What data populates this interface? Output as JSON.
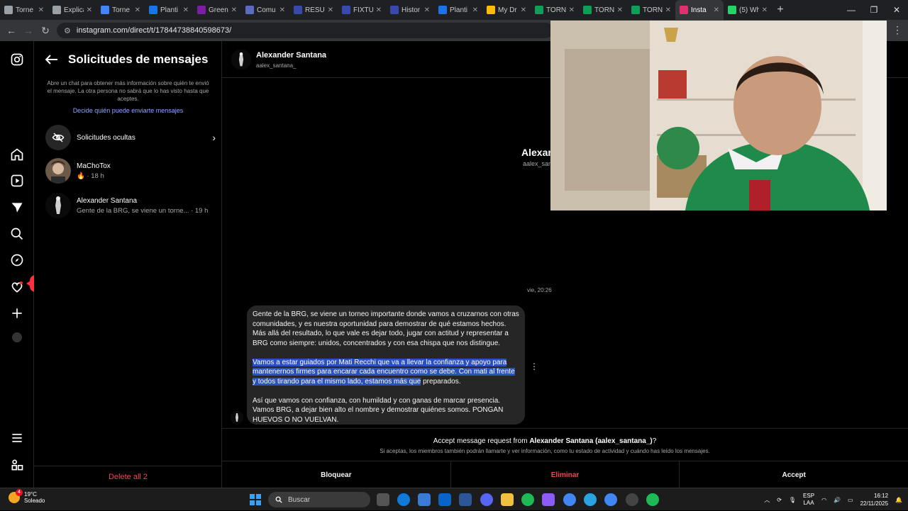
{
  "browser": {
    "tabs": [
      {
        "label": "Torne",
        "color": "#9aa0a6"
      },
      {
        "label": "Explica",
        "color": "#9aa0a6"
      },
      {
        "label": "Torne",
        "color": "#4285f4"
      },
      {
        "label": "Planti",
        "color": "#1a73e8"
      },
      {
        "label": "Green",
        "color": "#7b1fa2"
      },
      {
        "label": "Comu",
        "color": "#5c6bc0"
      },
      {
        "label": "RESUI",
        "color": "#3949ab"
      },
      {
        "label": "FIXTU",
        "color": "#3949ab"
      },
      {
        "label": "Histor",
        "color": "#3949ab"
      },
      {
        "label": "Planti",
        "color": "#1a73e8"
      },
      {
        "label": "My Dr",
        "color": "#fbbc04"
      },
      {
        "label": "TORN",
        "color": "#0f9d58"
      },
      {
        "label": "TORN",
        "color": "#0f9d58"
      },
      {
        "label": "TORN",
        "color": "#0f9d58"
      },
      {
        "label": "Insta",
        "color": "#e1306c",
        "active": true
      },
      {
        "label": "(5) Wh",
        "color": "#25d366"
      }
    ],
    "url": "instagram.com/direct/t/17844738840598673/"
  },
  "requests": {
    "title": "Solicitudes de mensajes",
    "info": "Abre un chat para obtener más información sobre quién te envió el mensaje. La otra persona no sabrá que lo has visto hasta que aceptes.",
    "link": "Decide quién puede enviarte mensajes",
    "hidden_label": "Solicitudes ocultas",
    "conversations": [
      {
        "name": "MaChoTox",
        "sub": "🔥 · 18 h"
      },
      {
        "name": "Alexander Santana",
        "sub": "Gente de la BRG, se viene un torne... · 19 h"
      }
    ],
    "delete_all": "Delete all 2"
  },
  "notifications": {
    "likes": "1",
    "follows": "5"
  },
  "chat": {
    "name": "Alexander Santana",
    "username": "aalex_santana_",
    "profile_partial_name": "Alexan",
    "profile_partial_user": "aalex_san",
    "timestamp": "vie, 20:26",
    "message": {
      "p1": "Gente de la BRG, se viene un torneo importante donde vamos a cruzarnos con otras comunidades, y es nuestra oportunidad para demostrar de qué estamos hechos. Más allá del resultado, lo que vale es dejar todo, jugar con actitud y representar a BRG como siempre: unidos, concentrados y con esa chispa que nos distingue.",
      "p2_highlighted": "Vamos a estar guiados por Mati Recchi que va a llevar la confianza y apoyo para mantenernos firmes para encarar cada encuentro como se debe. Con mati al frente y todos tirando para el mismo lado, estamos más que",
      "p2_rest": " preparados.",
      "p3": "Así que vamos con confianza, con humildad y con ganas de marcar presencia. Vamos BRG, a dejar bien alto el nombre y demostrar quiénes somos. PONGAN HUEVOS O NO VUELVAN."
    },
    "accept_prefix": "Accept message request from ",
    "accept_name": "Alexander Santana (aalex_santana_)",
    "accept_suffix": "?",
    "accept_note": "Si aceptas, los miembros también podrán llamarte y ver información, como tu estado de actividad y cuándo has leído los mensajes.",
    "actions": {
      "block": "Bloquear",
      "delete": "Eliminar",
      "accept": "Accept"
    }
  },
  "taskbar": {
    "weather_badge": "4",
    "temp": "19°C",
    "condition": "Soleado",
    "search_placeholder": "Buscar",
    "lang_top": "ESP",
    "lang_bottom": "LAA",
    "time": "16:12",
    "date": "22/11/2025"
  }
}
